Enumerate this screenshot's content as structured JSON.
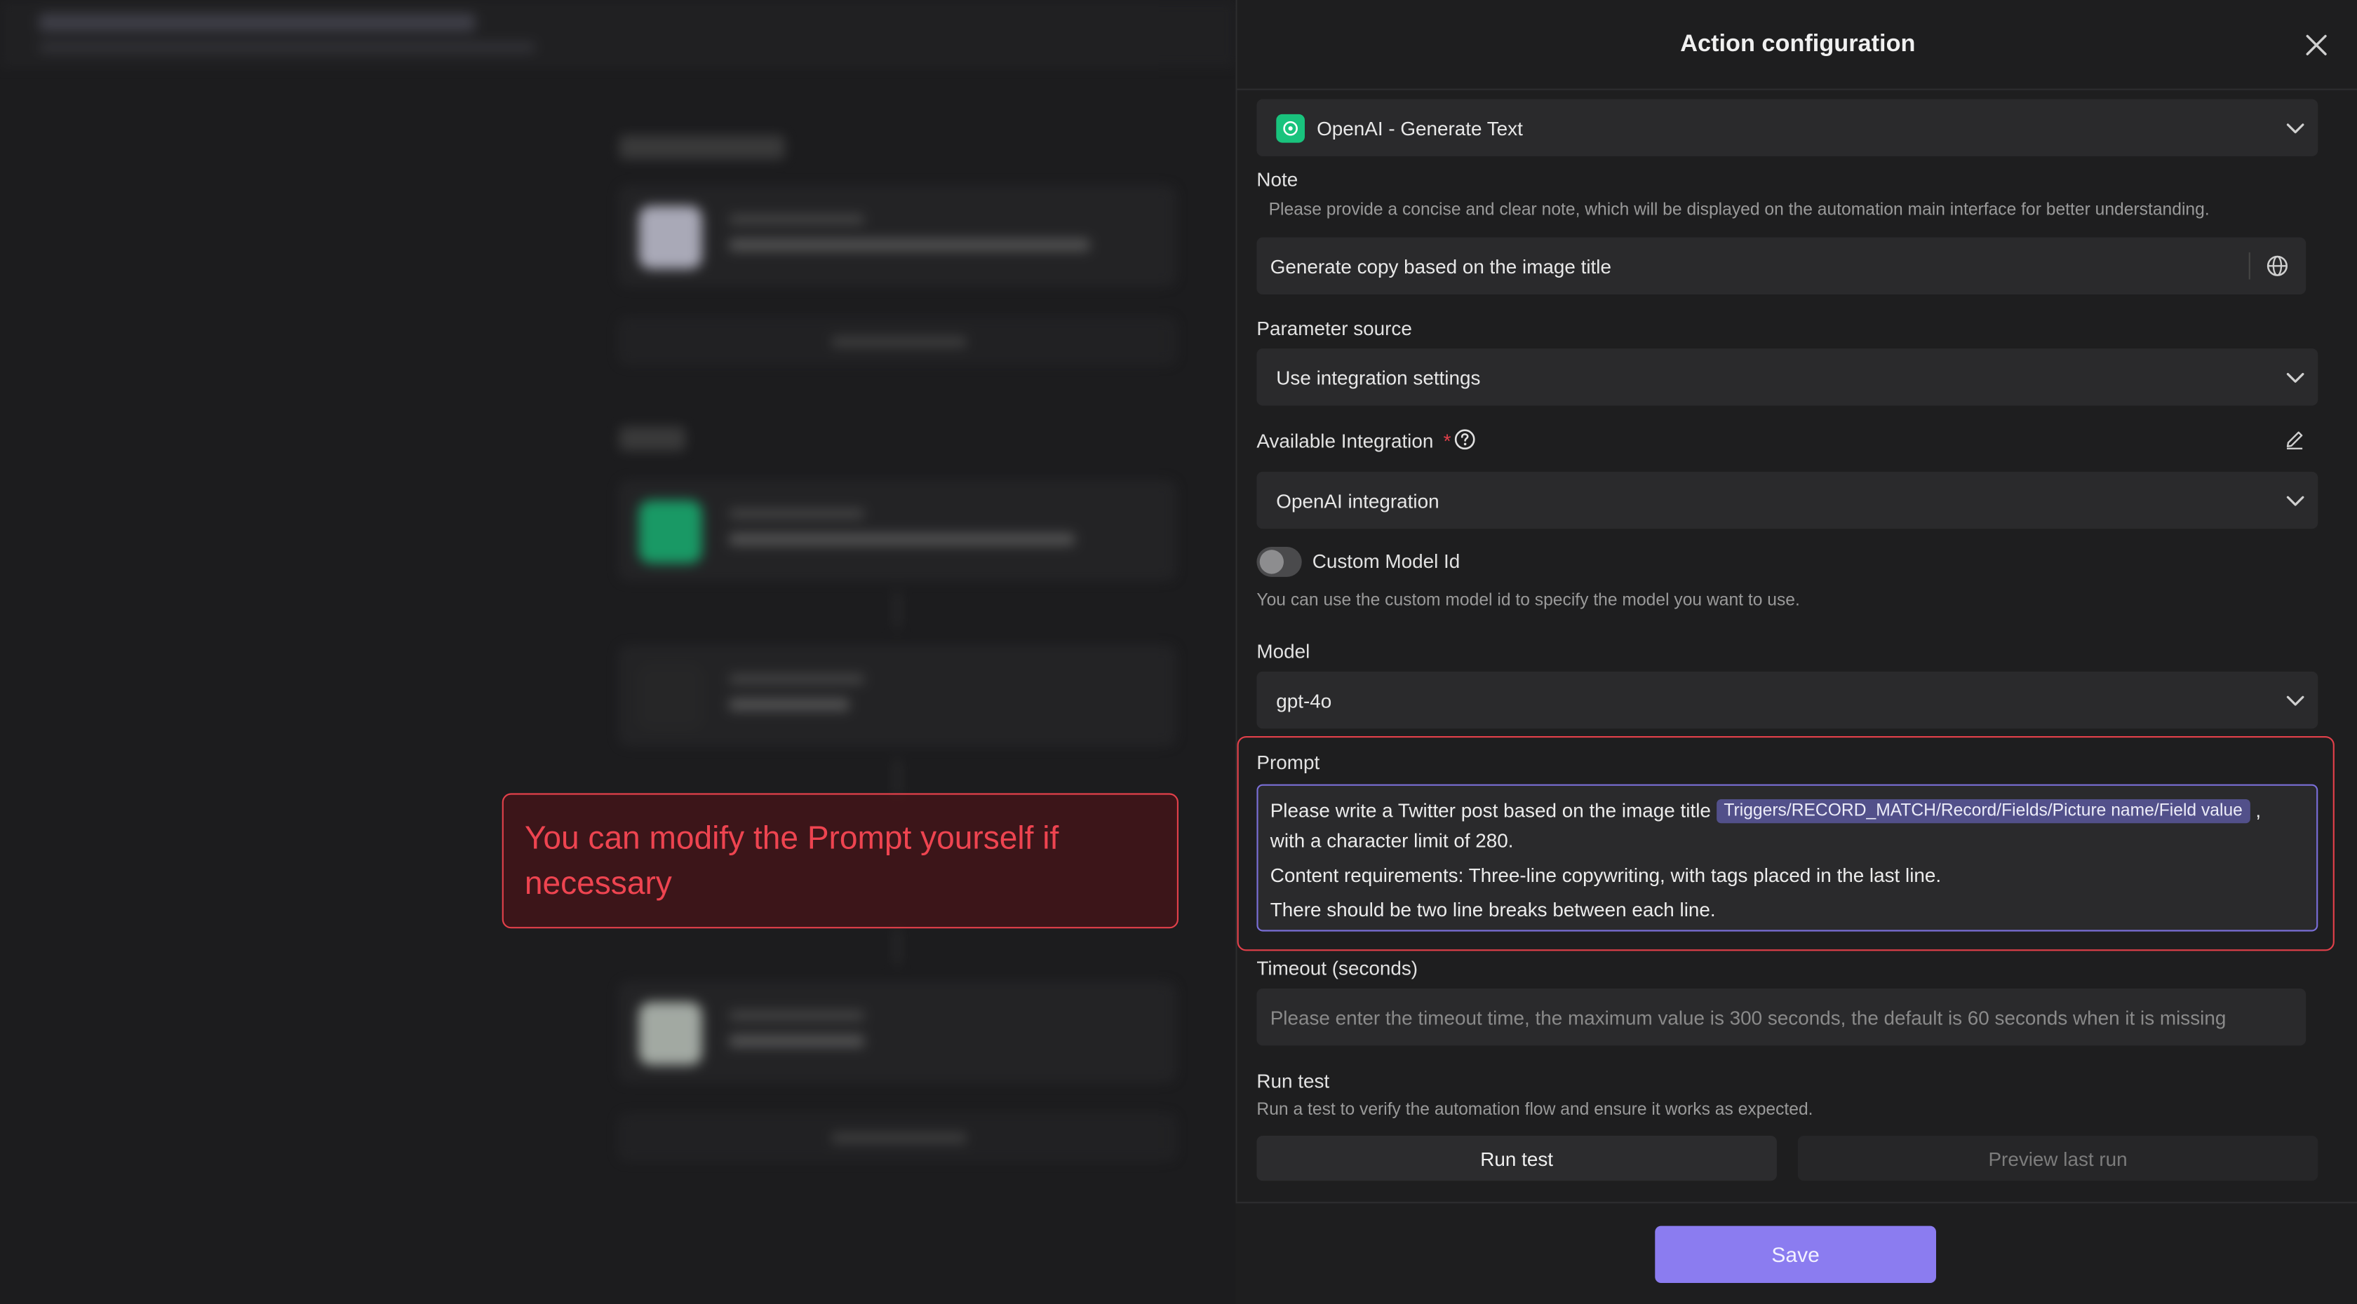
{
  "background": {
    "callout_text": "You can modify the Prompt yourself if necessary"
  },
  "panel": {
    "title": "Action configuration",
    "action_select": {
      "value": "OpenAI - Generate Text",
      "icon": "openai-icon"
    },
    "note": {
      "label": "Note",
      "hint": "Please provide a concise and clear note, which will be displayed on the automation main interface for better understanding.",
      "value": "Generate copy based on the image title"
    },
    "parameter_source": {
      "label": "Parameter source",
      "value": "Use integration settings"
    },
    "available_integration": {
      "label": "Available Integration",
      "required_mark": "*",
      "value": "OpenAI integration"
    },
    "custom_model": {
      "label": "Custom Model Id",
      "hint": "You can use the custom model id to specify the model you want to use.",
      "enabled": false
    },
    "model": {
      "label": "Model",
      "value": "gpt-4o"
    },
    "prompt": {
      "label": "Prompt",
      "line1_text": "Please write a Twitter post based on the image title",
      "variable_tag": "Triggers/RECORD_MATCH/Record/Fields/Picture name/Field value",
      "line1_suffix": ",",
      "line2": "with a character limit of 280.",
      "line3": "Content requirements: Three-line copywriting, with tags placed in the last line.",
      "line4": "There should be two line breaks between each line."
    },
    "timeout": {
      "label": "Timeout (seconds)",
      "placeholder": "Please enter the timeout time, the maximum value is 300 seconds, the default is 60 seconds when it is missing"
    },
    "run_test": {
      "label": "Run test",
      "hint": "Run a test to verify the automation flow and ensure it works as expected.",
      "run_button": "Run test",
      "preview_button": "Preview last run"
    },
    "save_button": "Save"
  },
  "colors": {
    "accent": "#8b7cf0",
    "highlight_red": "#e2404a",
    "openai_green": "#19c37d",
    "tag_bg": "#52508a"
  }
}
